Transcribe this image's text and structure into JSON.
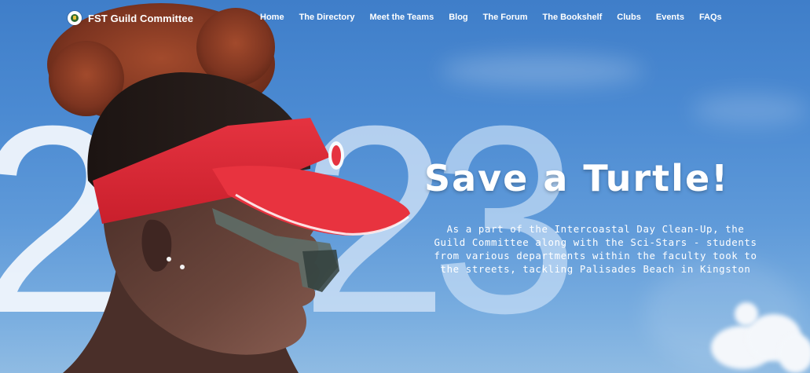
{
  "brand": {
    "name": "FST Guild Committee",
    "logo_icon": "guild-crest-icon"
  },
  "nav": {
    "items": [
      {
        "label": "Home"
      },
      {
        "label": "The Directory"
      },
      {
        "label": "Meet the Teams"
      },
      {
        "label": "Blog"
      },
      {
        "label": "The Forum"
      },
      {
        "label": "The Bookshelf"
      },
      {
        "label": "Clubs"
      },
      {
        "label": "Events"
      },
      {
        "label": "FAQs"
      }
    ]
  },
  "hero": {
    "year_digits": [
      "2",
      "2",
      "3"
    ],
    "headline": "Save a Turtle!",
    "body": "As a part of the Intercoastal Day Clean-Up, the Guild Committee along with the Sci-Stars - students from various departments within the faculty took to the streets, tackling Palisades Beach in Kingston",
    "colors": {
      "sky": "#4b8ad2",
      "visor": "#e53340",
      "hair": "#8a3c24"
    }
  }
}
